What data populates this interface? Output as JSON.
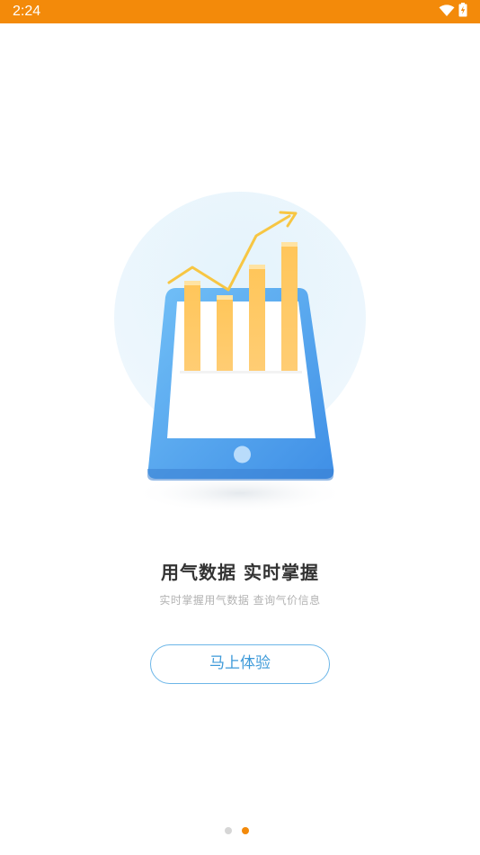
{
  "status_bar": {
    "time": "2:24",
    "background_color": "#f38a0a",
    "icons": [
      "wifi-icon",
      "battery-charging-icon"
    ]
  },
  "hero": {
    "illustration": "tablet-bar-chart-illustration",
    "bar_count": 4
  },
  "title": "用气数据  实时掌握",
  "subtitle": "实时掌握用气数据  查询气价信息",
  "cta": {
    "label": "马上体验",
    "border_color": "#6cb6e8",
    "text_color": "#3d9ad9"
  },
  "pager": {
    "total": 2,
    "active_index": 1,
    "active_color": "#f38a0a",
    "inactive_color": "#d6d6d6"
  }
}
